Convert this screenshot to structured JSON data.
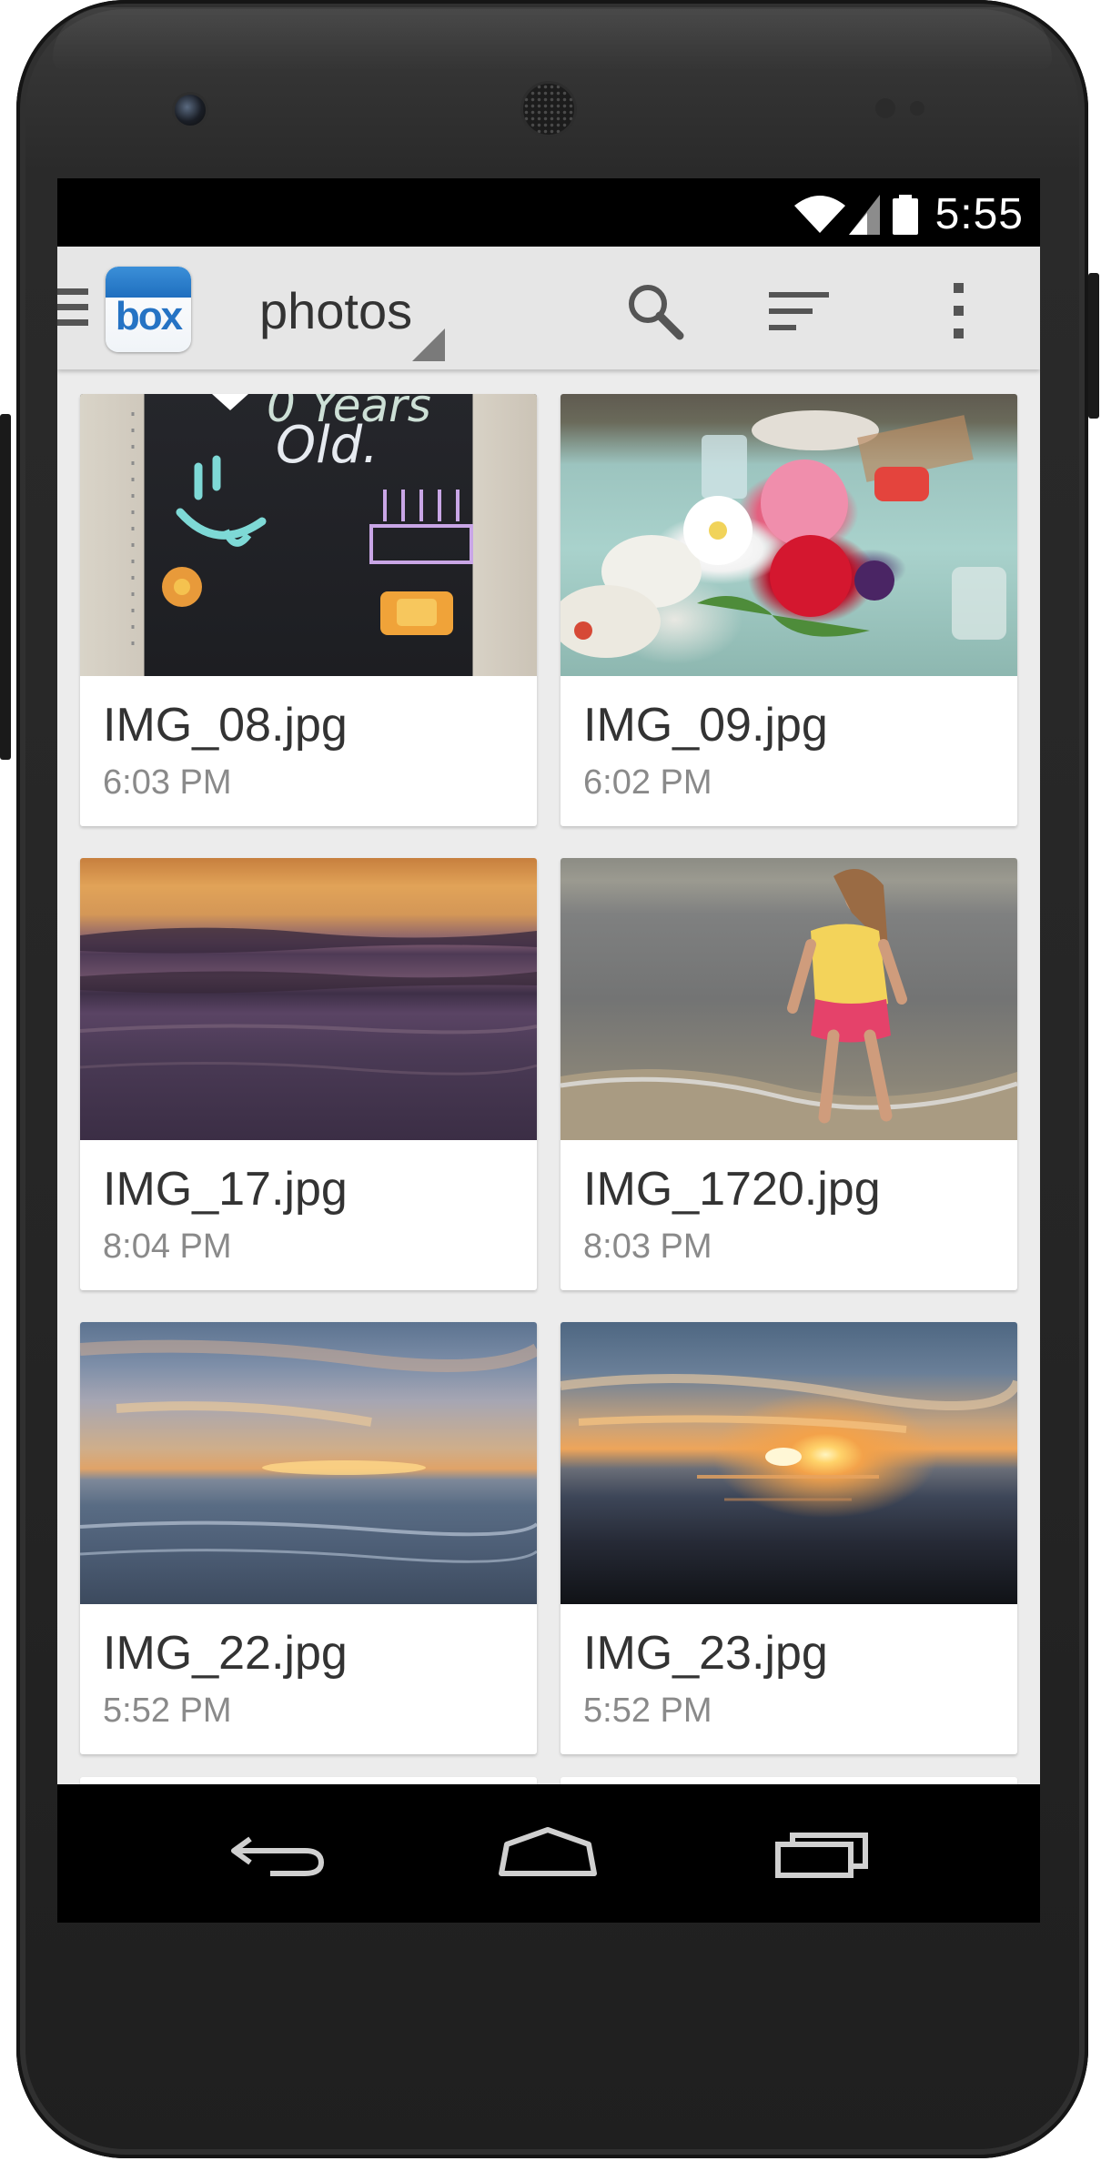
{
  "status_bar": {
    "time": "5:55",
    "icons": [
      "wifi-icon",
      "cell-signal-icon",
      "battery-icon"
    ]
  },
  "action_bar": {
    "app_logo_text": "box",
    "folder_title": "photos",
    "actions": [
      "search-icon",
      "sort-icon",
      "overflow-menu-icon"
    ]
  },
  "files": [
    {
      "name": "IMG_08.jpg",
      "time": "6:03 PM"
    },
    {
      "name": "IMG_09.jpg",
      "time": "6:02 PM"
    },
    {
      "name": "IMG_17.jpg",
      "time": "8:04 PM"
    },
    {
      "name": "IMG_1720.jpg",
      "time": "8:03 PM"
    },
    {
      "name": "IMG_22.jpg",
      "time": "5:52 PM"
    },
    {
      "name": "IMG_23.jpg",
      "time": "5:52 PM"
    }
  ],
  "navigation": {
    "buttons": [
      "back-icon",
      "home-icon",
      "recents-icon"
    ]
  },
  "colors": {
    "action_bar_bg": "#e6e6e6",
    "content_bg": "#ececec",
    "title_text": "#333333",
    "subtitle_text": "#8a8a8a",
    "brand_blue": "#2573c4"
  }
}
